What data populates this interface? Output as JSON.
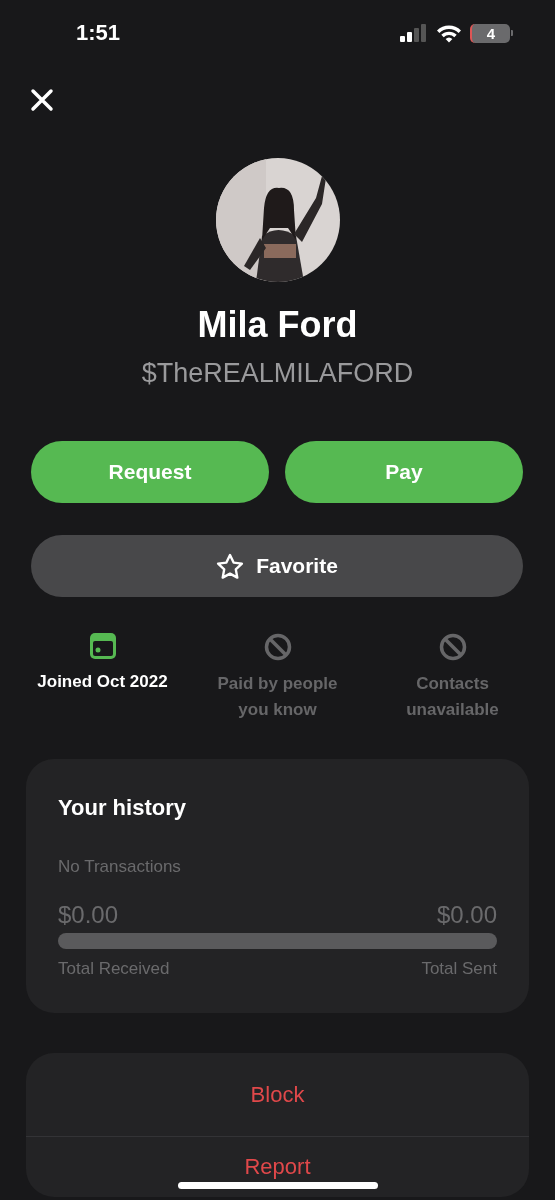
{
  "status_bar": {
    "time": "1:51",
    "battery": "4"
  },
  "profile": {
    "name": "Mila Ford",
    "handle": "$TheREALMILAFORD"
  },
  "actions": [
    {
      "label": "Request",
      "kind": "primary"
    },
    {
      "label": "Pay",
      "kind": "primary"
    }
  ],
  "favorite": {
    "label": "Favorite",
    "on": false
  },
  "facts": [
    {
      "label": "Joined Oct 2022",
      "kind": "calendar",
      "enabled": true
    },
    {
      "label": "Paid by people you know",
      "kind": "blocked",
      "enabled": false
    },
    {
      "label": "Contacts unavailable",
      "kind": "blocked",
      "enabled": false
    }
  ],
  "history": {
    "title": "Your history",
    "note": "No Transactions",
    "received_amount": "$0.00",
    "sent_amount": "$0.00",
    "received_label": "Total Received",
    "sent_label": "Total Sent"
  },
  "options": [
    "Block",
    "Report"
  ]
}
